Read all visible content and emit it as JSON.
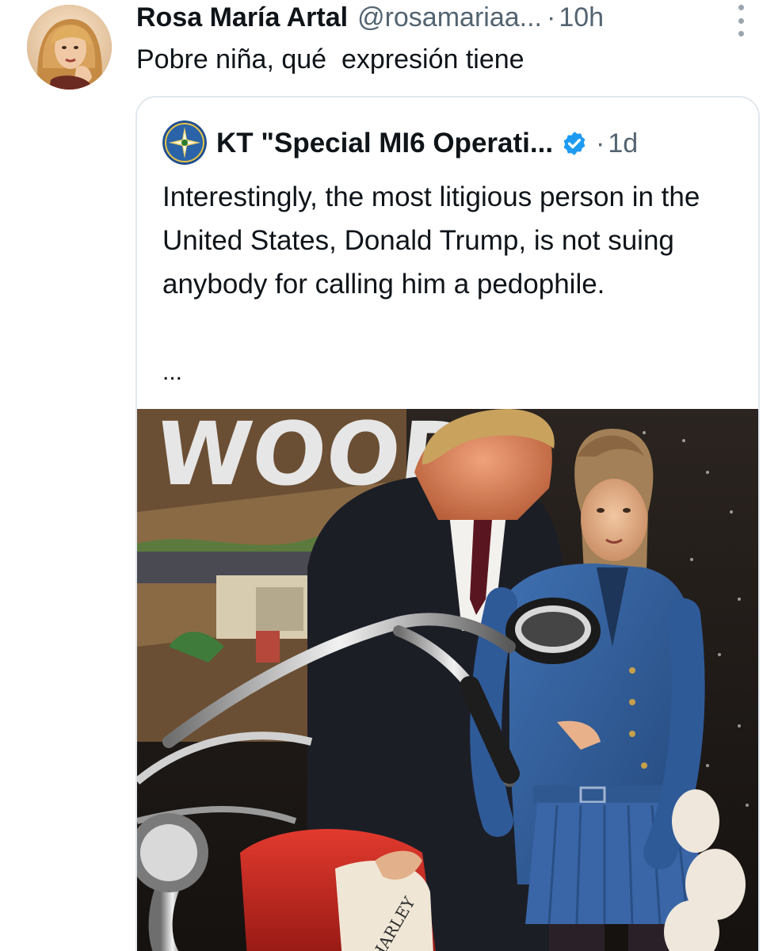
{
  "tweet": {
    "display_name": "Rosa María Artal",
    "handle": "@rosamariaa...",
    "separator": "·",
    "time": "10h",
    "text": "Pobre niña, qué  expresión tiene"
  },
  "quoted_tweet": {
    "display_name": "KT \"Special MI6 Operati...",
    "separator": "·",
    "time": "1d",
    "text": "Interestingly, the most litigious person in the United States, Donald Trump, is not suing anybody for calling him a pedophile.",
    "truncation": "...",
    "image_sign_text": "WOOD",
    "image_tank_text": "HARLEY"
  },
  "colors": {
    "verified_badge": "#1d9bf0",
    "muted_text": "#536471",
    "border": "#e1e8ed"
  },
  "icons": {
    "more": "more-options-icon",
    "verified": "verified-badge-icon"
  }
}
